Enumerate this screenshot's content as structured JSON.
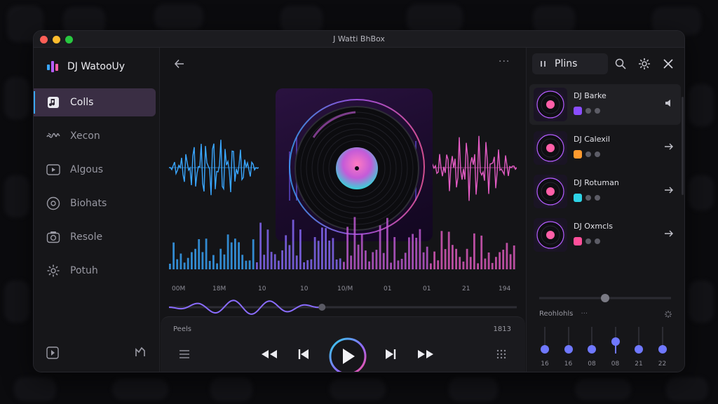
{
  "window": {
    "title": "J Watti BhBox"
  },
  "sidebar": {
    "brand": "DJ WatooUy",
    "items": [
      {
        "label": "Colls",
        "icon": "music-note-icon",
        "active": true
      },
      {
        "label": "Xecon",
        "icon": "waveform-icon"
      },
      {
        "label": "Algous",
        "icon": "play-box-icon"
      },
      {
        "label": "Biohats",
        "icon": "disc-icon"
      },
      {
        "label": "Resole",
        "icon": "camera-icon"
      },
      {
        "label": "Potuh",
        "icon": "gear-icon"
      }
    ]
  },
  "main": {
    "more_label": "···",
    "timeline": [
      "00M",
      "18M",
      "10",
      "10",
      "10/M",
      "01",
      "01",
      "21",
      "194"
    ],
    "progress_fraction": 0.44,
    "controls_label": "Peels",
    "controls_time": "1813"
  },
  "panel": {
    "tab_label": "Plins",
    "tracks": [
      {
        "name": "DJ Barke",
        "badge_color": "#8a4dff",
        "active": true
      },
      {
        "name": "DJ Calexil",
        "badge_color": "#ff9a2e"
      },
      {
        "name": "DJ Rotuman",
        "badge_color": "#2ed3e6"
      },
      {
        "name": "DJ Oxmcls",
        "badge_color": "#ff4f9a"
      }
    ],
    "top_slider_fraction": 0.5,
    "eq_title": "Reohlohls",
    "eq_bands": [
      {
        "label": "16",
        "level": 0.15
      },
      {
        "label": "16",
        "level": 0.15
      },
      {
        "label": "08",
        "level": 0.15
      },
      {
        "label": "08",
        "level": 0.45
      },
      {
        "label": "21",
        "level": 0.15
      },
      {
        "label": "22",
        "level": 0.15
      }
    ],
    "bottom_slider_fraction": 0.5
  },
  "colors": {
    "accent": "#6f78ff",
    "cyan": "#3aa7ff",
    "pink": "#e35cc4"
  }
}
